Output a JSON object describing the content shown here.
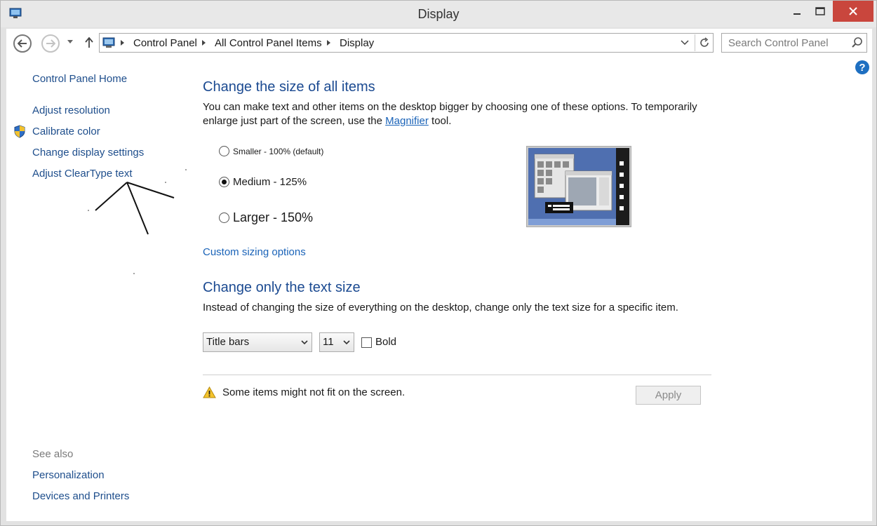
{
  "window": {
    "title": "Display"
  },
  "nav": {
    "breadcrumbs": [
      "Control Panel",
      "All Control Panel Items",
      "Display"
    ],
    "search_placeholder": "Search Control Panel"
  },
  "sidebar": {
    "home": "Control Panel Home",
    "items": [
      "Adjust resolution",
      "Calibrate color",
      "Change display settings",
      "Adjust ClearType text"
    ],
    "see_also_label": "See also",
    "see_also": [
      "Personalization",
      "Devices and Printers"
    ]
  },
  "size_section": {
    "heading": "Change the size of all items",
    "desc_line1": "You can make text and other items on the desktop bigger by choosing one of these options. To temporarily",
    "desc_line2_before": "enlarge just part of the screen, use the ",
    "desc_link": "Magnifier",
    "desc_line2_after": " tool.",
    "options": [
      {
        "label": "Smaller - 100% (default)",
        "checked": false
      },
      {
        "label": "Medium - 125%",
        "checked": true
      },
      {
        "label": "Larger - 150%",
        "checked": false
      }
    ],
    "custom_link": "Custom sizing options"
  },
  "text_section": {
    "heading": "Change only the text size",
    "desc": "Instead of changing the size of everything on the desktop, change only the text size for a specific item.",
    "item_select": "Title bars",
    "size_select": "11",
    "bold_label": "Bold",
    "bold_checked": false
  },
  "footer": {
    "warning": "Some items might not fit on the screen.",
    "apply_label": "Apply"
  },
  "colors": {
    "heading": "#1b4a91",
    "link": "#1a63b8",
    "close_button": "#c9463d"
  }
}
